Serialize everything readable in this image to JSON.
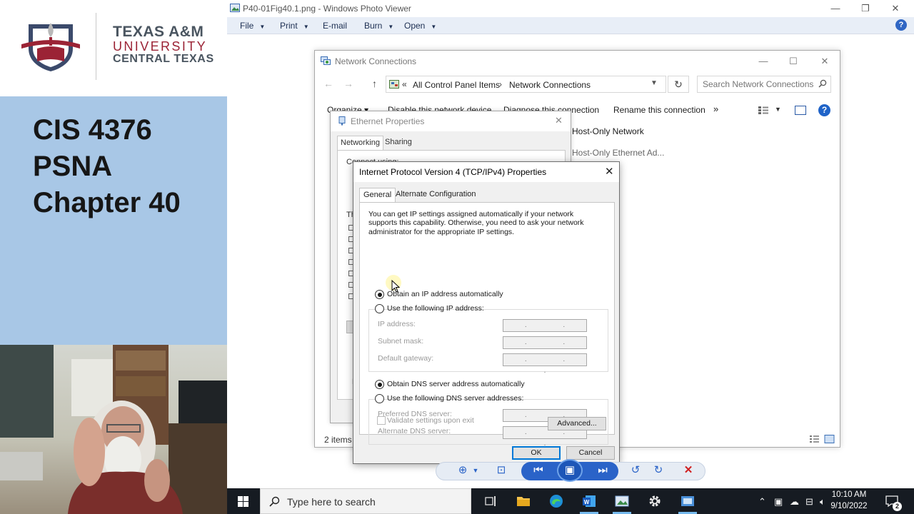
{
  "lecture": {
    "logo_line1": "TEXAS A&M",
    "logo_line2": "UNIVERSITY",
    "logo_line3": "CENTRAL TEXAS",
    "course_line1": "CIS 4376",
    "course_line2": "PSNA",
    "course_line3": "Chapter 40"
  },
  "viewer": {
    "title": "P40-01Fig40.1.png - Windows Photo Viewer",
    "menu": [
      "File",
      "Print",
      "E-mail",
      "Burn",
      "Open"
    ],
    "help": "?"
  },
  "network": {
    "title": "Network Connections",
    "address_prefix": "«",
    "breadcrumb": [
      "All Control Panel Items",
      "Network Connections"
    ],
    "breadcrumb_sep": "›",
    "search_placeholder": "Search Network Connections",
    "commands": [
      "Organize ▾",
      "Disable this network device",
      "Diagnose this connection",
      "Rename this connection"
    ],
    "more": "»",
    "help": "?",
    "adapters": [
      "Host-Only Network",
      "Host-Only Ethernet Ad..."
    ],
    "items_count": "2 items"
  },
  "ethernet": {
    "title": "Ethernet Properties",
    "tabs": [
      "Networking",
      "Sharing"
    ],
    "connect_label": "Connect using:",
    "this_label": "Th",
    "desc_label": "D"
  },
  "ipv4": {
    "title": "Internet Protocol Version 4 (TCP/IPv4) Properties",
    "tabs": [
      "General",
      "Alternate Configuration"
    ],
    "info": "You can get IP settings assigned automatically if your network supports this capability. Otherwise, you need to ask your network administrator for the appropriate IP settings.",
    "ip_auto": "Obtain an IP address automatically",
    "ip_manual": "Use the following IP address:",
    "ip_fields": [
      "IP address:",
      "Subnet mask:",
      "Default gateway:"
    ],
    "dns_auto": "Obtain DNS server address automatically",
    "dns_manual": "Use the following DNS server addresses:",
    "dns_fields": [
      "Preferred DNS server:",
      "Alternate DNS server:"
    ],
    "ip_placeholder": ". . .",
    "validate": "Validate settings upon exit",
    "advanced": "Advanced...",
    "ok": "OK",
    "cancel": "Cancel",
    "ip_mode": "automatic",
    "dns_mode": "automatic"
  },
  "taskbar": {
    "search_text": "Type here to search",
    "time": "10:10 AM",
    "date": "9/10/2022",
    "notifications": "2"
  },
  "colors": {
    "panel_blue": "#a8c7e6",
    "maroon": "#9b2335",
    "accent": "#0078d7",
    "taskbar": "#161b22"
  }
}
